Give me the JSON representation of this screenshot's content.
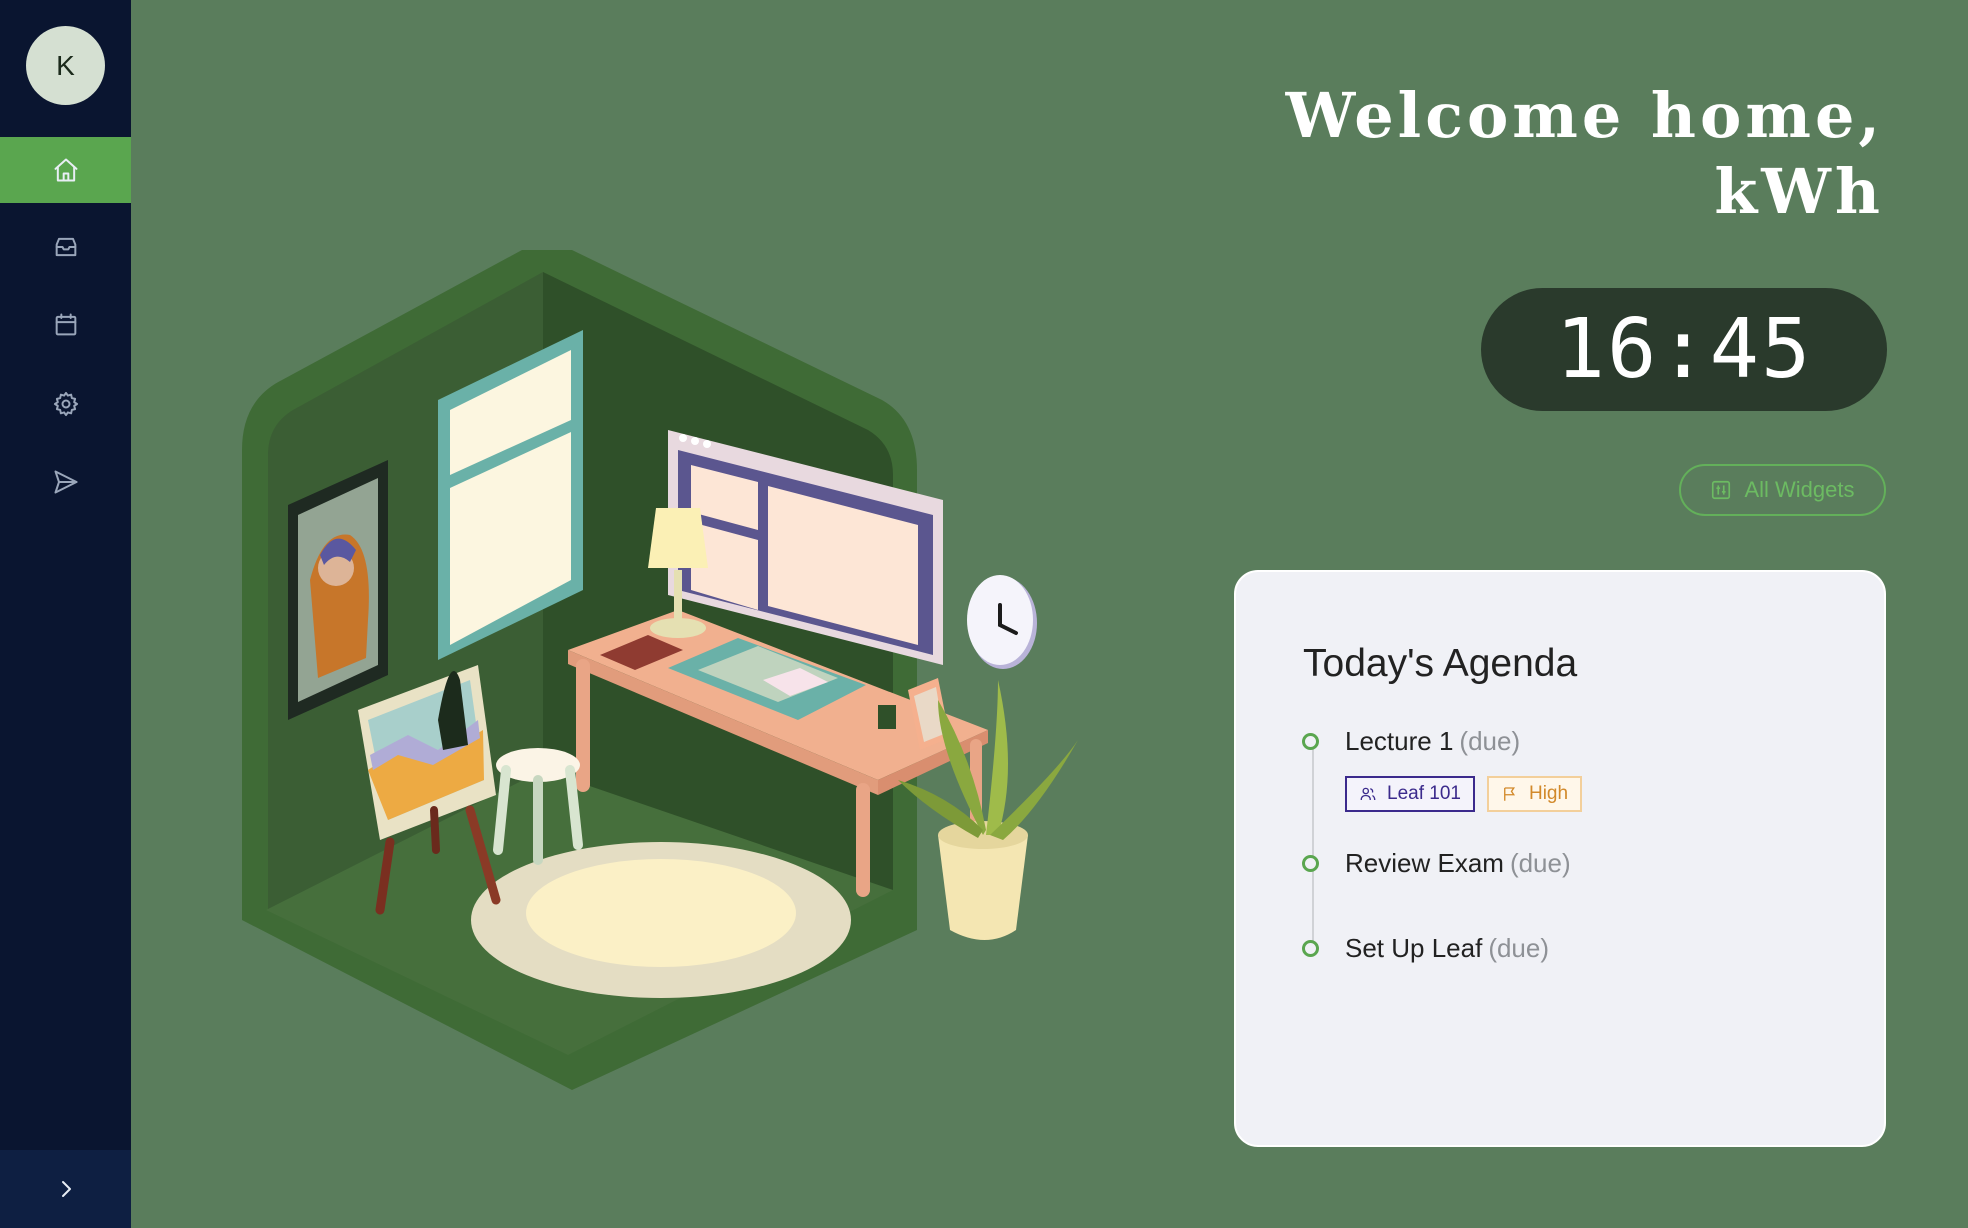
{
  "sidebar": {
    "avatar_initial": "K",
    "items": [
      {
        "name": "home",
        "icon": "home-icon",
        "active": true
      },
      {
        "name": "inbox",
        "icon": "inbox-icon",
        "active": false
      },
      {
        "name": "calendar",
        "icon": "calendar-icon",
        "active": false
      },
      {
        "name": "settings",
        "icon": "gear-icon",
        "active": false
      },
      {
        "name": "send",
        "icon": "send-icon",
        "active": false
      }
    ],
    "collapse_icon": "chevron-right-icon"
  },
  "header": {
    "welcome_line1": "Welcome home,",
    "welcome_line2": "kWh"
  },
  "clock": {
    "time": "16:45"
  },
  "widgets_button": {
    "label": "All Widgets",
    "icon": "widgets-icon"
  },
  "agenda": {
    "title": "Today's Agenda",
    "items": [
      {
        "name": "Lecture 1",
        "status": "(due)",
        "tags": [
          {
            "label": "Leaf 101",
            "icon": "users-icon"
          },
          {
            "label": "High",
            "icon": "flag-icon"
          }
        ]
      },
      {
        "name": "Review Exam",
        "status": "(due)"
      },
      {
        "name": "Set Up Leaf",
        "status": "(due)"
      }
    ]
  },
  "colors": {
    "background": "#5a7d5c",
    "sidebar": "#0a1530",
    "accent": "#5aa64f",
    "clock_bg": "#2a3a2c",
    "card_bg": "#f0f1f6"
  }
}
